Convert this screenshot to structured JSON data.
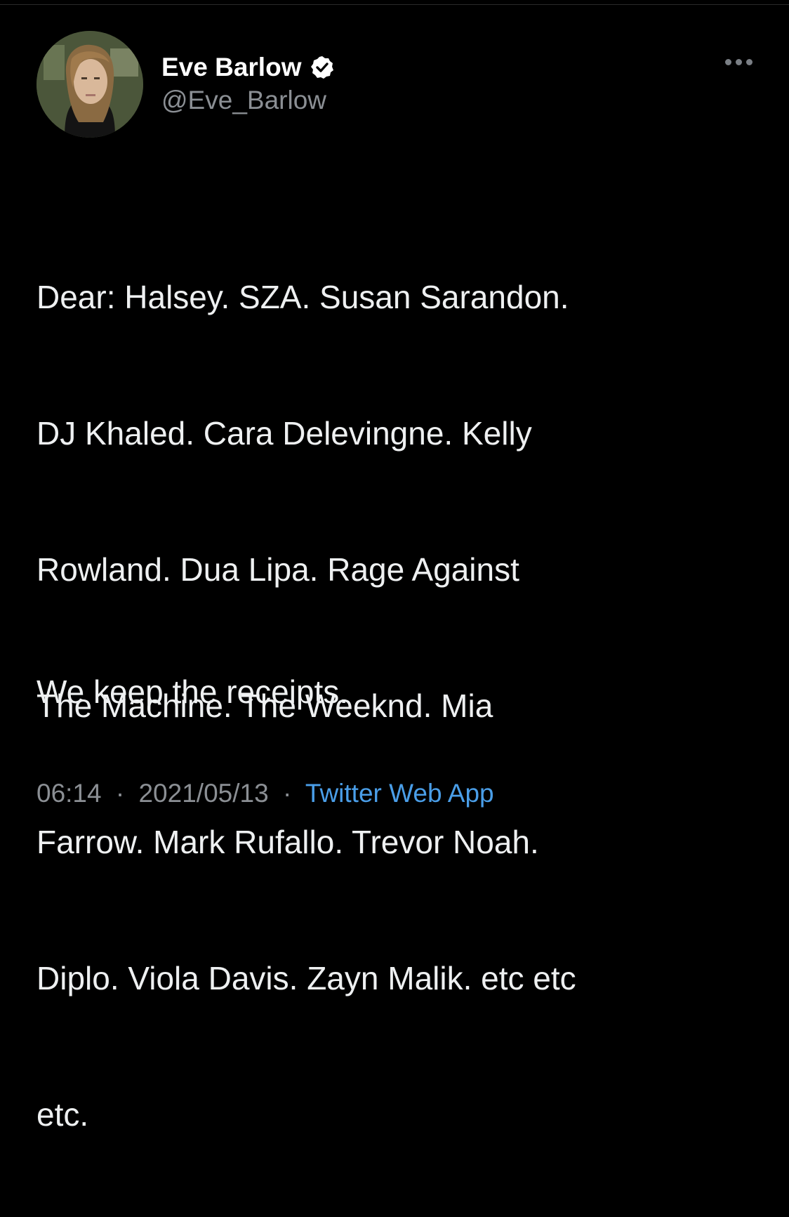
{
  "tweet": {
    "author": {
      "display_name": "Eve Barlow",
      "handle": "@Eve_Barlow",
      "verified": true,
      "avatar_icon": "profile-photo"
    },
    "more_icon": "more-dots-icon",
    "text_lines": [
      "Dear: Halsey. SZA. Susan Sarandon.",
      "DJ Khaled. Cara Delevingne. Kelly",
      "Rowland. Dua Lipa. Rage Against",
      "The Machine. The Weeknd. Mia",
      "Farrow. Mark Rufallo. Trevor Noah.",
      "Diplo. Viola Davis. Zayn Malik. etc etc",
      "etc."
    ],
    "second_paragraph": "We keep the receipts.",
    "time": "06:14",
    "date": "2021/05/13",
    "separator": "·",
    "source": "Twitter Web App"
  },
  "colors": {
    "background": "#000000",
    "text": "#eef0f1",
    "secondary": "#8b8f94",
    "link": "#4a9ee8"
  }
}
